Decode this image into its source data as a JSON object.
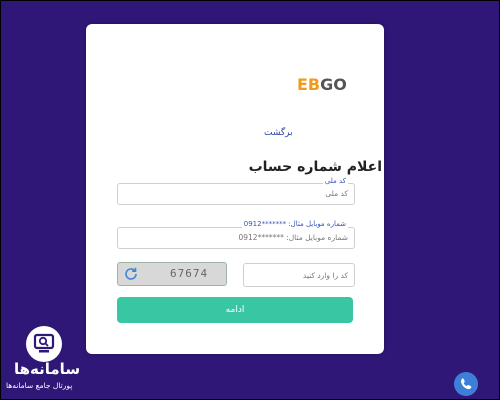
{
  "card": {
    "logo": {
      "prefix": "EB",
      "suffix": "GO"
    },
    "back_link": "برگشت",
    "title": "اعلام شماره حساب",
    "national_id": {
      "label": "کد ملی",
      "placeholder": "کد ملی"
    },
    "mobile": {
      "label": "شماره موبایل مثال: *******0912",
      "placeholder": "شماره موبایل مثال: *******0912"
    },
    "captcha": {
      "image_text": "67674",
      "placeholder": "کد  را وارد کنید"
    },
    "submit_label": "ادامه"
  },
  "brand": {
    "name": "سامانه‌ها",
    "subtitle": "پورتال جامع سامانه‌ها"
  },
  "colors": {
    "background": "#2f1778",
    "accent": "#39c7a3",
    "link": "#2b43a8",
    "logo_orange": "#f29a1f"
  }
}
